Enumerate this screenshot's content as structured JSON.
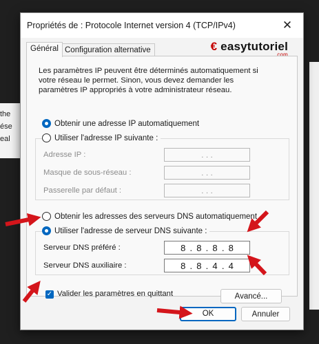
{
  "dialog": {
    "title": "Propriétés de : Protocole Internet version 4 (TCP/IPv4)",
    "close_glyph": "✕"
  },
  "tabs": [
    {
      "label": "Général"
    },
    {
      "label": "Configuration alternative"
    }
  ],
  "brand": {
    "text": "easytutoriel",
    "suffix": ".com"
  },
  "intro_text": "Les paramètres IP peuvent être déterminés automatiquement si votre réseau le permet. Sinon, vous devez demander les paramètres IP appropriés à votre administrateur réseau.",
  "ip": {
    "auto_label": "Obtenir une adresse IP automatiquement",
    "manual_label": "Utiliser l'adresse IP suivante :",
    "fields": [
      {
        "label": "Adresse IP :",
        "value": ". . ."
      },
      {
        "label": "Masque de sous-réseau :",
        "value": ". . ."
      },
      {
        "label": "Passerelle par défaut :",
        "value": ". . ."
      }
    ]
  },
  "dns": {
    "auto_label": "Obtenir les adresses des serveurs DNS automatiquement",
    "manual_label": "Utiliser l'adresse de serveur DNS suivante :",
    "preferred_label": "Serveur DNS préféré :",
    "preferred_octets": [
      "8",
      "8",
      "8",
      "8"
    ],
    "alternate_label": "Serveur DNS auxiliaire :",
    "alternate_octets": [
      "8",
      "8",
      "4",
      "4"
    ]
  },
  "validate_label": "Valider les paramètres en quittant",
  "buttons": {
    "advanced": "Avancé...",
    "ok": "OK",
    "cancel": "Annuler"
  },
  "background_fragments": [
    "the",
    "ése",
    "eal"
  ],
  "colors": {
    "accent": "#0067c0",
    "arrow": "#d4151b"
  }
}
